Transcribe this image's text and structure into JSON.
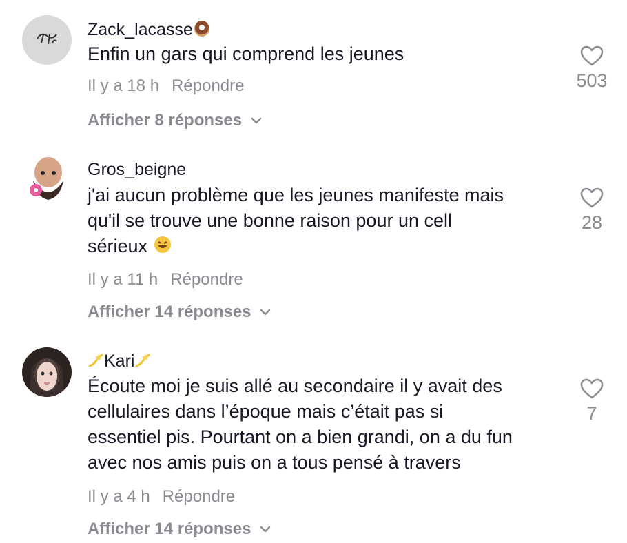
{
  "comments": [
    {
      "username": "Zack_lacasse",
      "text": "Enfin un gars qui comprend les jeunes",
      "time": "Il y a 18 h",
      "reply_label": "Répondre",
      "likes": "503",
      "view_replies": "Afficher 8 réponses"
    },
    {
      "username": "Gros_beigne",
      "text_lines": [
        "j'ai aucun problème que les jeunes manifeste mais",
        "qu'il se trouve une bonne raison pour un cell",
        "sérieux"
      ],
      "time": "Il y a 11 h",
      "reply_label": "Répondre",
      "likes": "28",
      "view_replies": "Afficher 14 réponses"
    },
    {
      "username": "Kari",
      "text_lines": [
        "Écoute moi je suis allé au secondaire il y avait des",
        "cellulaires dans l’époque mais c’était pas si",
        "essentiel pis. Pourtant on a bien grandi, on a du fun",
        "avec nos amis puis on a tous pensé à travers"
      ],
      "time": "Il y a 4 h",
      "reply_label": "Répondre",
      "likes": "7",
      "view_replies": "Afficher 14 réponses"
    }
  ],
  "colors": {
    "text": "#161823",
    "secondary": "#8a8b91"
  }
}
